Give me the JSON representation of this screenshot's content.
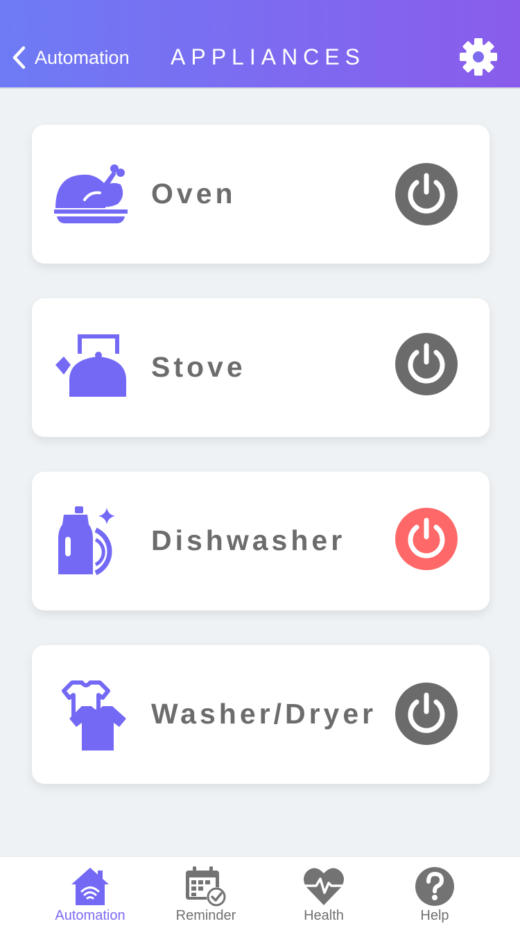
{
  "header": {
    "back_label": "Automation",
    "title": "APPLIANCES",
    "settings_icon": "gear-icon"
  },
  "appliances": [
    {
      "name": "Oven",
      "icon": "roast-chicken-icon",
      "power": "off",
      "power_color": "#6b6b6b"
    },
    {
      "name": "Stove",
      "icon": "kettle-icon",
      "power": "off",
      "power_color": "#6b6b6b"
    },
    {
      "name": "Dishwasher",
      "icon": "dish-soap-icon",
      "power": "on",
      "power_color": "#ff6868"
    },
    {
      "name": "Washer/Dryer",
      "icon": "laundry-shirts-icon",
      "power": "off",
      "power_color": "#6b6b6b"
    }
  ],
  "tabs": [
    {
      "label": "Automation",
      "icon": "smart-home-icon",
      "active": true
    },
    {
      "label": "Reminder",
      "icon": "calendar-check-icon",
      "active": false
    },
    {
      "label": "Health",
      "icon": "heart-pulse-icon",
      "active": false
    },
    {
      "label": "Help",
      "icon": "question-circle-icon",
      "active": false
    }
  ],
  "colors": {
    "accent": "#7a6af5",
    "header_start": "#6e7bf5",
    "header_end": "#8a5cec",
    "power_off": "#6b6b6b",
    "power_on": "#ff6868",
    "tab_inactive": "#707070"
  }
}
